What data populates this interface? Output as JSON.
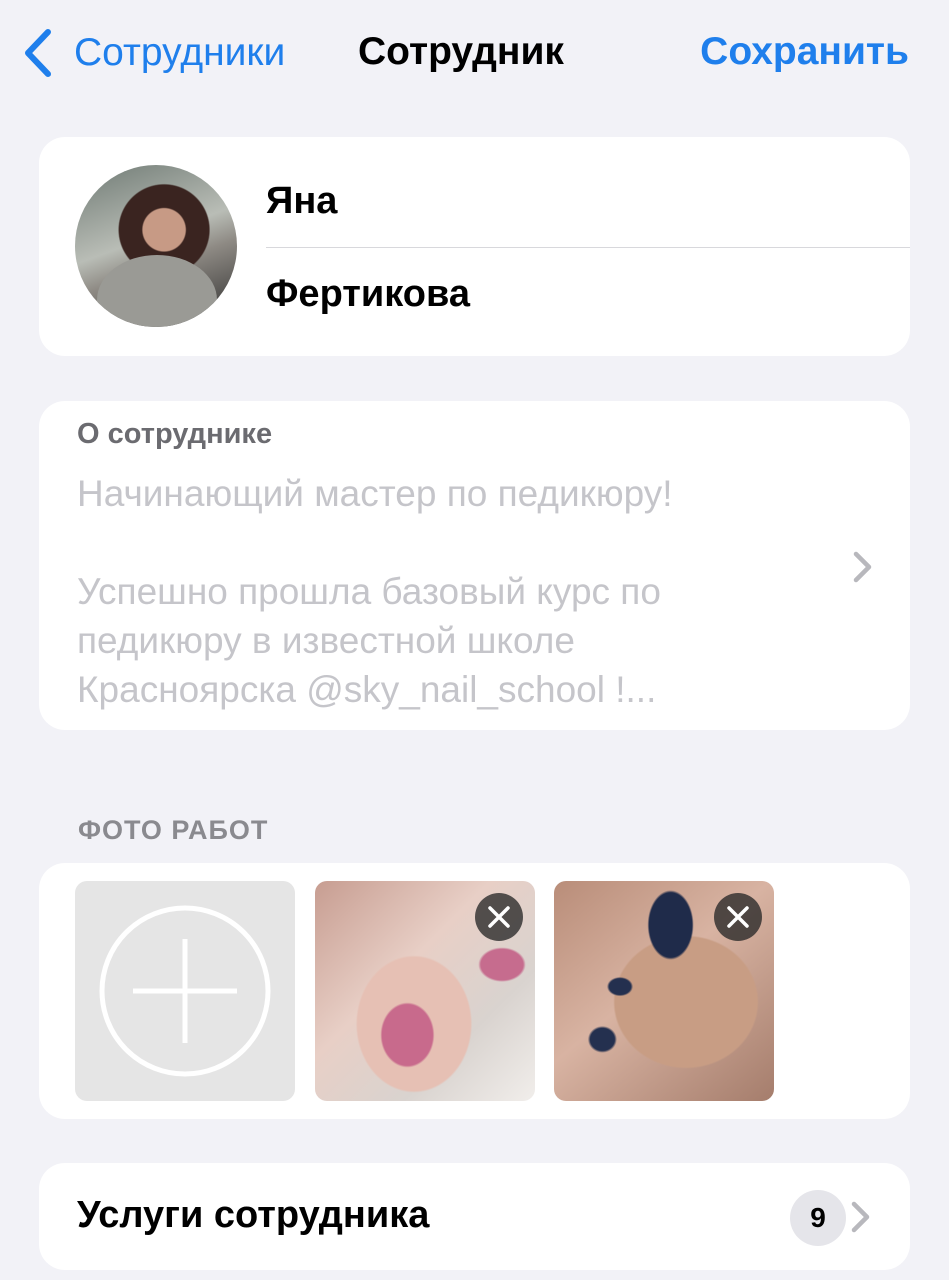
{
  "nav": {
    "back_label": "Сотрудники",
    "title": "Сотрудник",
    "save_label": "Сохранить"
  },
  "profile": {
    "first_name": "Яна",
    "last_name": "Фертикова"
  },
  "about": {
    "label": "О сотруднике",
    "text": "Начинающий мастер по педикюру!\n\nУспешно прошла базовый курс по педикюру в известной школе Красноярска @sky_nail_school !..."
  },
  "photos": {
    "section_header": "ФОТО РАБОТ",
    "items": [
      "add-photo",
      "pink-glitter-pedicure",
      "navy-pedicure"
    ]
  },
  "services": {
    "label": "Услуги сотрудника",
    "count": "9"
  },
  "colors": {
    "accent": "#1f7fec",
    "background": "#f2f2f7",
    "placeholder_text": "#c5c5ca"
  }
}
